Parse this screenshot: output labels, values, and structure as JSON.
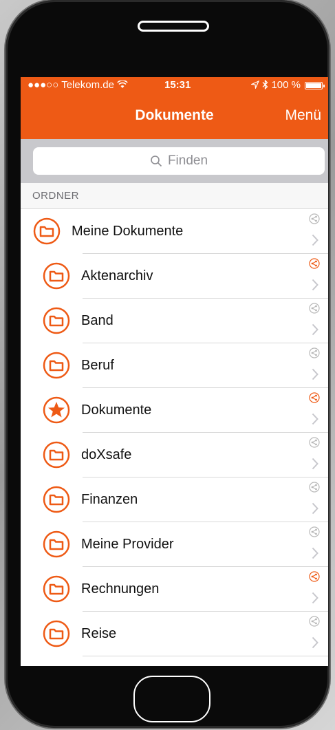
{
  "status": {
    "signal": "●●●○○",
    "carrier": "Telekom.de",
    "time": "15:31",
    "battery": "100 %"
  },
  "nav": {
    "title": "Dokumente",
    "menu_label": "Menü"
  },
  "search": {
    "placeholder": "Finden"
  },
  "section_header": "ORDNER",
  "colors": {
    "accent": "#ee5a15",
    "share_active": "#ee5a15",
    "share_inactive": "#b8b8b8"
  },
  "folders": [
    {
      "label": "Meine Dokumente",
      "icon": "folder-icon",
      "shared": false,
      "root": true
    },
    {
      "label": "Aktenarchiv",
      "icon": "folder-icon",
      "shared": true
    },
    {
      "label": "Band",
      "icon": "folder-icon",
      "shared": false
    },
    {
      "label": "Beruf",
      "icon": "folder-icon",
      "shared": false
    },
    {
      "label": "Dokumente",
      "icon": "star-icon",
      "shared": true
    },
    {
      "label": "doXsafe",
      "icon": "folder-icon",
      "shared": false
    },
    {
      "label": "Finanzen",
      "icon": "folder-icon",
      "shared": false
    },
    {
      "label": "Meine Provider",
      "icon": "folder-icon",
      "shared": false
    },
    {
      "label": "Rechnungen",
      "icon": "folder-icon",
      "shared": true
    },
    {
      "label": "Reise",
      "icon": "folder-icon",
      "shared": false
    }
  ]
}
